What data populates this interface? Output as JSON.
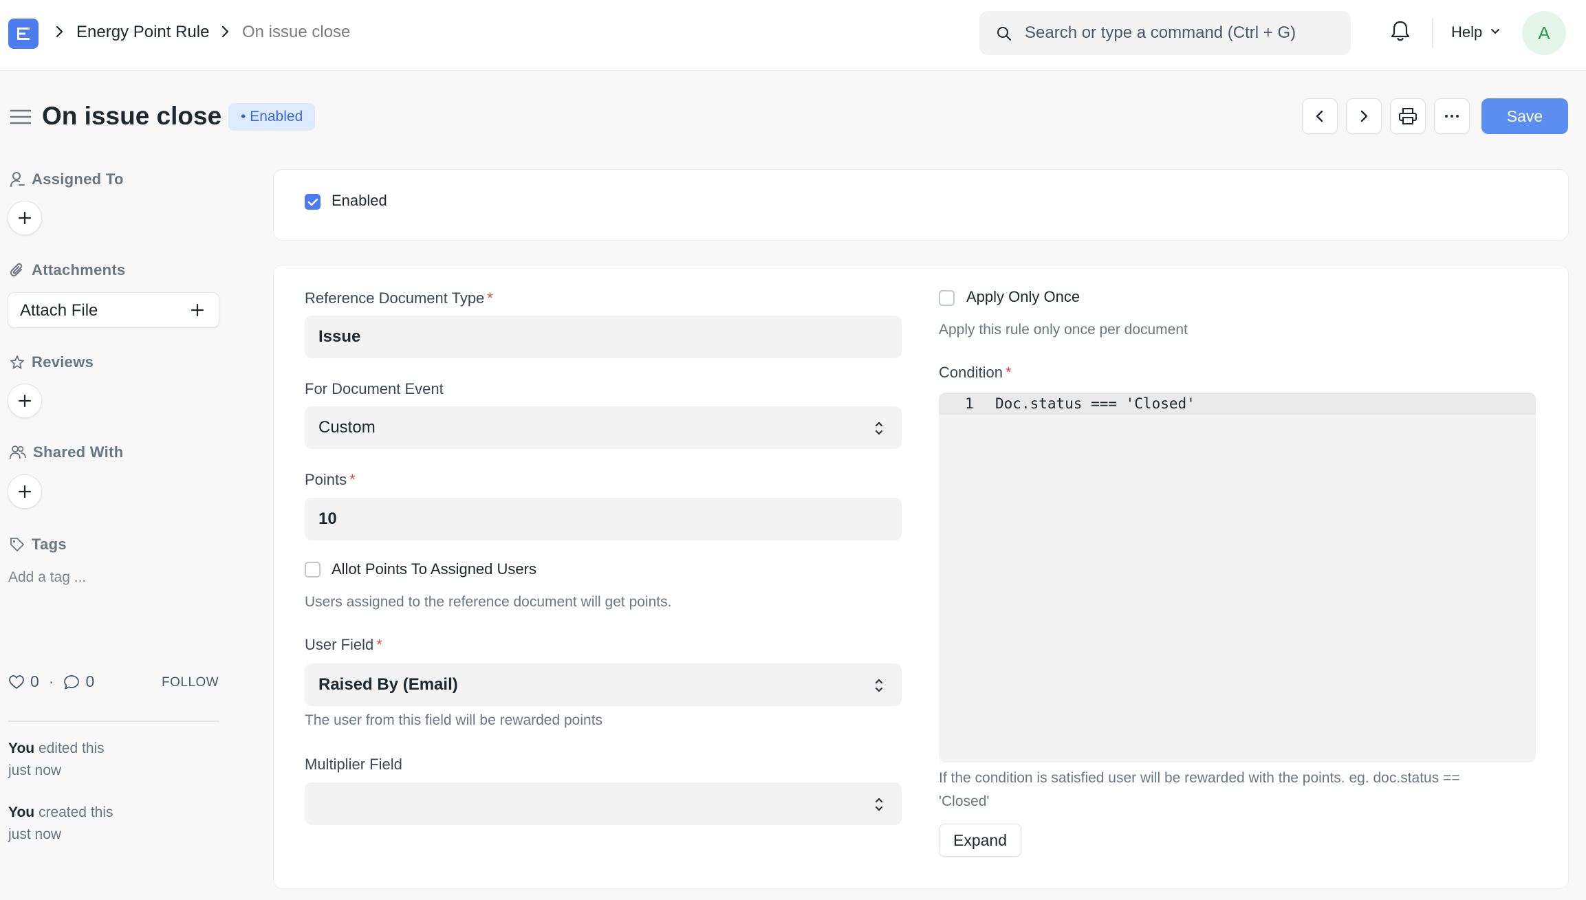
{
  "navbar": {
    "breadcrumbs": [
      "Energy Point Rule",
      "On issue close"
    ],
    "search_placeholder": "Search or type a command (Ctrl + G)",
    "help_label": "Help",
    "avatar_initial": "A"
  },
  "page": {
    "title": "On issue close",
    "status_badge": "Enabled",
    "save_label": "Save"
  },
  "sidebar": {
    "assigned_to_label": "Assigned To",
    "attachments_label": "Attachments",
    "attach_file_label": "Attach File",
    "reviews_label": "Reviews",
    "shared_with_label": "Shared With",
    "tags_label": "Tags",
    "tag_placeholder": "Add a tag ...",
    "likes_count": "0",
    "comments_count": "0",
    "follow_label": "FOLLOW",
    "activity": [
      {
        "actor": "You",
        "action": " edited this",
        "time": "just now"
      },
      {
        "actor": "You",
        "action": " created this",
        "time": "just now"
      }
    ]
  },
  "form": {
    "enabled_label": "Enabled",
    "reference_doctype_label": "Reference Document Type",
    "reference_doctype_value": "Issue",
    "document_event_label": "For Document Event",
    "document_event_value": "Custom",
    "points_label": "Points",
    "points_value": "10",
    "allot_points_label": "Allot Points To Assigned Users",
    "allot_points_help": "Users assigned to the reference document will get points.",
    "user_field_label": "User Field",
    "user_field_value": "Raised By (Email)",
    "user_field_help": "The user from this field will be rewarded points",
    "multiplier_field_label": "Multiplier Field",
    "multiplier_field_value": "",
    "apply_once_label": "Apply Only Once",
    "apply_once_help": "Apply this rule only once per document",
    "condition_label": "Condition",
    "condition_line_number": "1",
    "condition_code": "Doc.status === 'Closed'",
    "condition_help_1": "If the condition is satisfied user will be rewarded with the points. eg. doc.status ==",
    "condition_help_2": "'Closed'",
    "expand_label": "Expand",
    "required_marker": "*"
  },
  "colors": {
    "primary": "#4c7cf0",
    "save": "#5a8ef0",
    "badge_bg": "#ddeaff",
    "badge_text": "#3a69cf",
    "required": "#e24c4c"
  }
}
